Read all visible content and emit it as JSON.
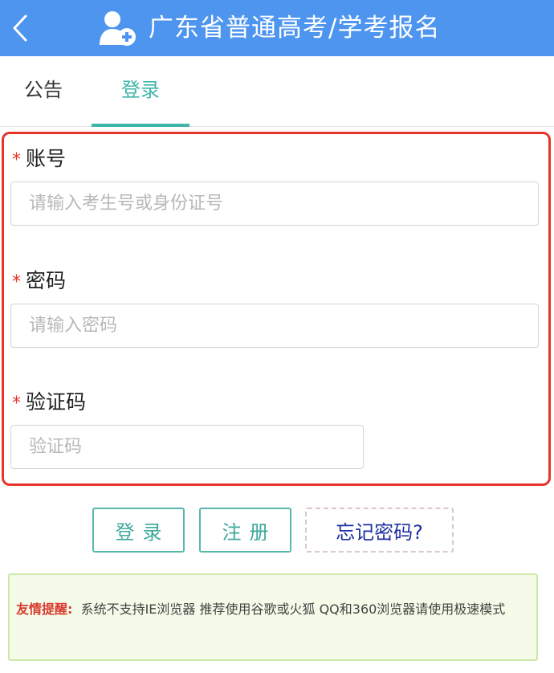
{
  "header": {
    "title": "广东省普通高考/学考报名",
    "back_icon": "chevron-left-icon",
    "user_icon": "user-add-icon",
    "background": "#4e95f0"
  },
  "tabs": [
    {
      "label": "公告",
      "active": false
    },
    {
      "label": "登录",
      "active": true
    }
  ],
  "form": {
    "required_mark": "*",
    "fields": [
      {
        "label": "账号",
        "placeholder": "请输入考生号或身份证号",
        "value": ""
      },
      {
        "label": "密码",
        "placeholder": "请输入密码",
        "value": ""
      },
      {
        "label": "验证码",
        "placeholder": "验证码",
        "value": ""
      }
    ],
    "highlight_color": "#e5352b"
  },
  "buttons": {
    "login": "登录",
    "register": "注册",
    "forgot": "忘记密码?"
  },
  "tip": {
    "title": "友情提醒:",
    "text": "系统不支持IE浏览器 推荐使用谷歌或火狐 QQ和360浏览器请使用极速模式"
  },
  "colors": {
    "accent": "#3fb5aa",
    "header": "#4e95f0",
    "alert_red": "#e5352b",
    "forgot_link": "#1c2fa0"
  }
}
